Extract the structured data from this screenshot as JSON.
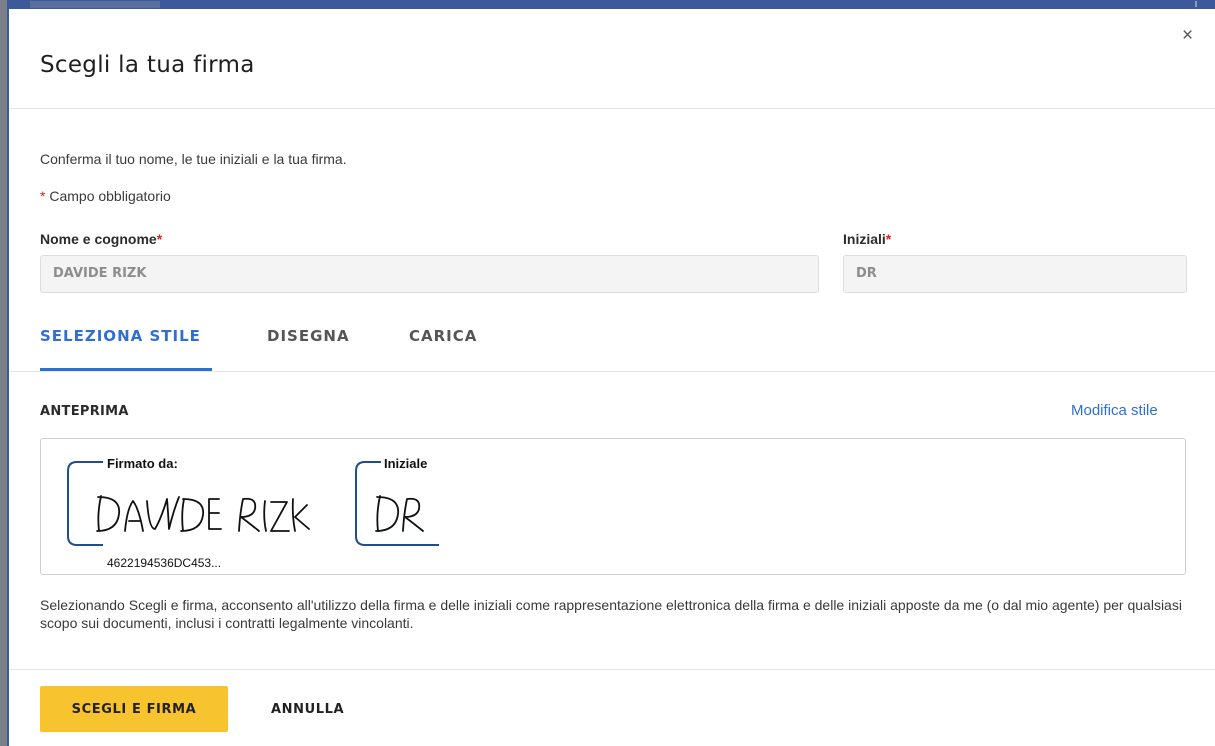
{
  "modal": {
    "title": "Scegli la tua firma",
    "close_icon": "×",
    "intro": "Conferma il tuo nome, le tue iniziali e la tua firma.",
    "required_star": "*",
    "required_note": " Campo obbligatorio"
  },
  "form": {
    "name_label": "Nome e cognome",
    "name_value": "DAVIDE RIZK",
    "initials_label": "Iniziali",
    "initials_value": "DR",
    "required_marker": "*"
  },
  "tabs": [
    {
      "label": "SELEZIONA STILE",
      "active": true
    },
    {
      "label": "DISEGNA",
      "active": false
    },
    {
      "label": "CARICA",
      "active": false
    }
  ],
  "preview": {
    "label": "ANTEPRIMA",
    "modify_link": "Modifica stile",
    "signature_caption": "Firmato da:",
    "signature_id": "4622194536DC453...",
    "initials_caption": "Iniziale",
    "signature_text": "DAVIDE RIZK",
    "initials_text": "DR"
  },
  "legal_text": "Selezionando Scegli e firma, acconsento all'utilizzo della firma e delle iniziali come rappresentazione elettronica della firma e delle iniziali apposte da me (o dal mio agente) per qualsiasi scopo sui documenti, inclusi i contratti legalmente vincolanti.",
  "footer": {
    "primary_button": "SCEGLI E FIRMA",
    "cancel_button": "ANNULLA"
  },
  "colors": {
    "accent": "#2f6fd1",
    "primary_button": "#f7c32e",
    "signature_frame": "#1f4e8c",
    "required": "#d9231d"
  }
}
